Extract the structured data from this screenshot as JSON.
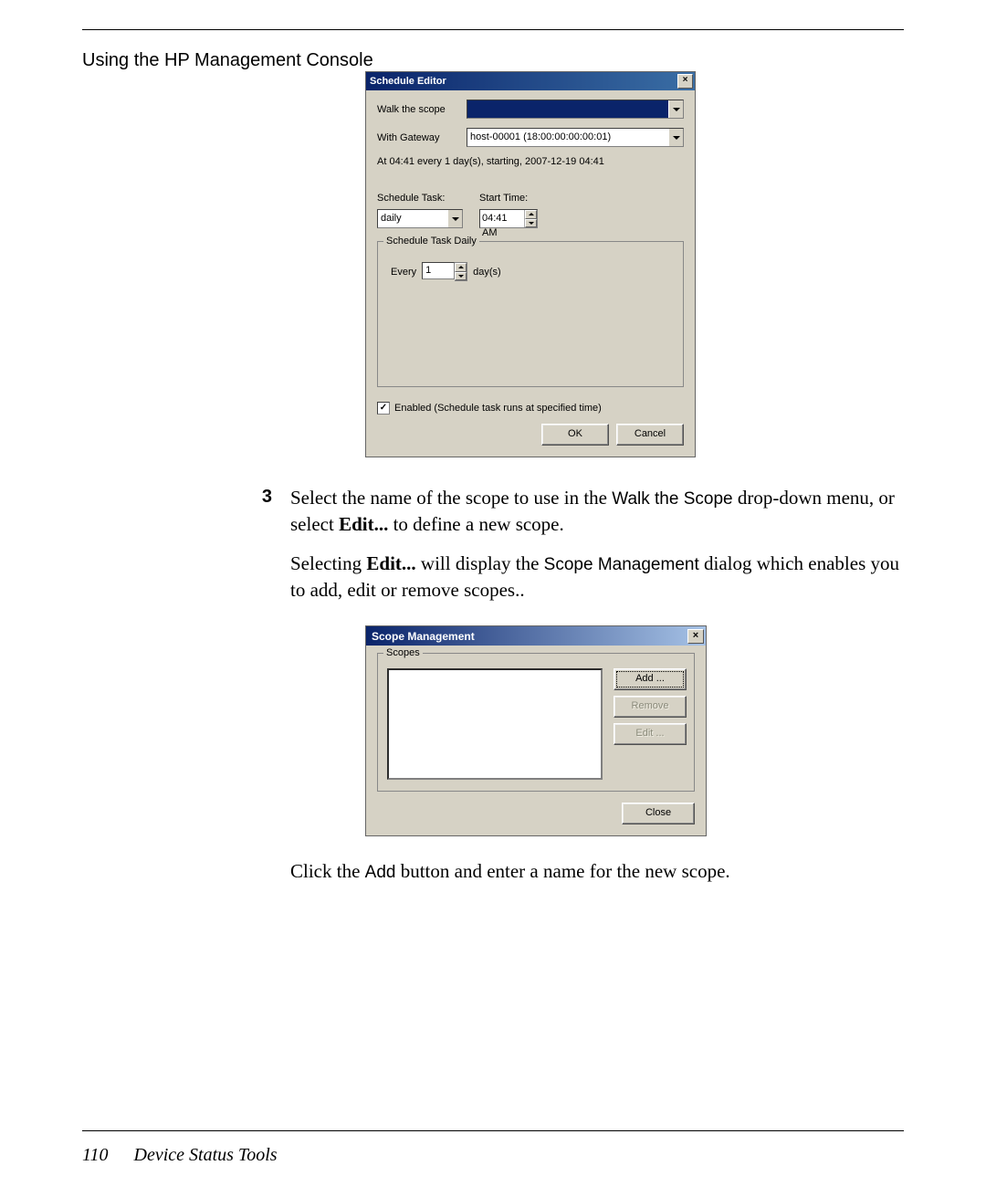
{
  "header": {
    "title": "Using the HP Management Console"
  },
  "dialog1": {
    "title": "Schedule Editor",
    "walk_label": "Walk the scope",
    "walk_value": "",
    "gateway_label": "With Gateway",
    "gateway_value": "host-00001 (18:00:00:00:00:01)",
    "summary": "At 04:41 every 1 day(s), starting, 2007-12-19 04:41",
    "schedule_task_label": "Schedule Task:",
    "schedule_task_value": "daily",
    "start_time_label": "Start Time:",
    "start_time_value": "04:41 AM",
    "group_legend": "Schedule Task Daily",
    "every_label": "Every",
    "every_value": "1",
    "days_label": "day(s)",
    "enabled_label": "Enabled (Schedule task runs at specified time)",
    "enabled_checked": "✓",
    "ok": "OK",
    "cancel": "Cancel"
  },
  "step": {
    "num": "3",
    "line1_a": "Select the name of the scope to use in the ",
    "line1_b": "Walk the Scope",
    "line1_c": " drop-down menu, or select ",
    "line1_d": "Edit...",
    "line1_e": " to define a new scope.",
    "line2_a": "Selecting ",
    "line2_b": "Edit...",
    "line2_c": " will display the ",
    "line2_d": "Scope Management",
    "line2_e": " dialog which enables you to add, edit or remove scopes.."
  },
  "dialog2": {
    "title": "Scope Management",
    "group_legend": "Scopes",
    "add": "Add ...",
    "remove": "Remove",
    "edit": "Edit ...",
    "close": "Close"
  },
  "after": {
    "a": "Click the ",
    "b": "Add",
    "c": " button and enter a name for the new scope."
  },
  "footer": {
    "page": "110",
    "section": "Device Status Tools"
  }
}
